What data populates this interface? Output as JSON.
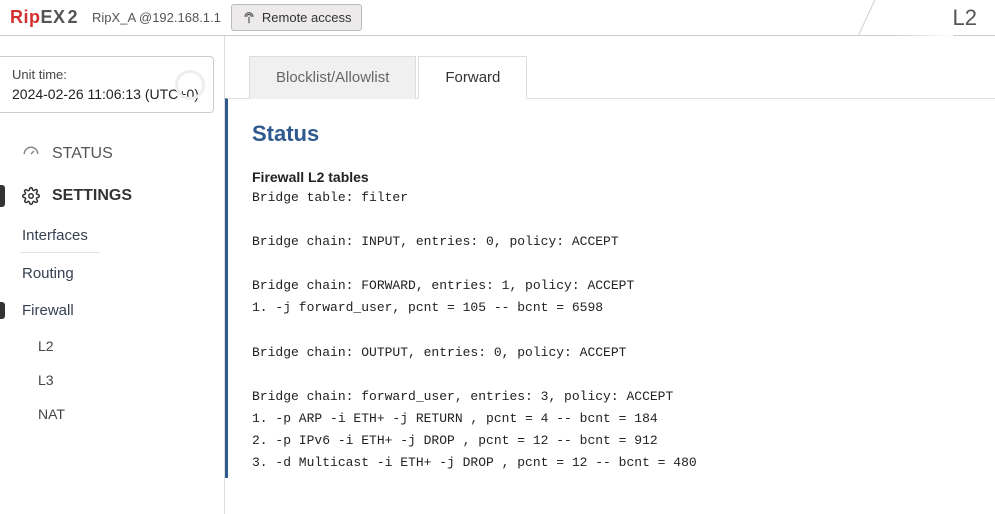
{
  "header": {
    "logo_rip": "Rip",
    "logo_ex": "EX",
    "logo_two": "2",
    "device": "RipX_A @192.168.1.1",
    "remote_btn": "Remote access",
    "page_badge": "L2"
  },
  "time": {
    "label": "Unit time:",
    "value": "2024-02-26 11:06:13 (UTC+0)"
  },
  "nav": {
    "status": "STATUS",
    "settings": "SETTINGS",
    "interfaces": "Interfaces",
    "routing": "Routing",
    "firewall": "Firewall",
    "l2": "L2",
    "l3": "L3",
    "nat": "NAT"
  },
  "tabs": {
    "blocklist": "Blocklist/Allowlist",
    "forward": "Forward"
  },
  "status_title": "Status",
  "fw_heading": "Firewall L2 tables",
  "fw_body": "Bridge table: filter\n\nBridge chain: INPUT, entries: 0, policy: ACCEPT\n\nBridge chain: FORWARD, entries: 1, policy: ACCEPT\n1. -j forward_user, pcnt = 105 -- bcnt = 6598\n\nBridge chain: OUTPUT, entries: 0, policy: ACCEPT\n\nBridge chain: forward_user, entries: 3, policy: ACCEPT\n1. -p ARP -i ETH+ -j RETURN , pcnt = 4 -- bcnt = 184\n2. -p IPv6 -i ETH+ -j DROP , pcnt = 12 -- bcnt = 912\n3. -d Multicast -i ETH+ -j DROP , pcnt = 12 -- bcnt = 480"
}
